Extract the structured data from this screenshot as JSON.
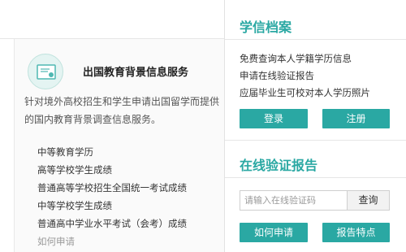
{
  "service": {
    "icon": "certificate-icon",
    "title": "出国教育背景信息服务",
    "description": "针对境外高校招生和学生申请出国留学而提供的国内教育背景调查信息服务。",
    "links": [
      {
        "label": "中等教育学历"
      },
      {
        "label": "高等学校学生成绩"
      },
      {
        "label": "普通高等学校招生全国统一考试成绩"
      },
      {
        "label": "中等学校学生成绩"
      },
      {
        "label": "普通高中学业水平考试（会考）成绩"
      },
      {
        "label": "如何申请"
      }
    ]
  },
  "archive": {
    "title": "学信档案",
    "items": [
      "免费查询本人学籍学历信息",
      "申请在线验证报告",
      "应届毕业生可校对本人学历照片"
    ],
    "login_label": "登录",
    "register_label": "注册"
  },
  "verify": {
    "title": "在线验证报告",
    "placeholder": "请输入在线验证码",
    "search_label": "查询",
    "how_to_label": "如何申请",
    "features_label": "报告特点"
  },
  "colors": {
    "accent": "#2aa8a3",
    "panel_bg": "#fafafa"
  }
}
